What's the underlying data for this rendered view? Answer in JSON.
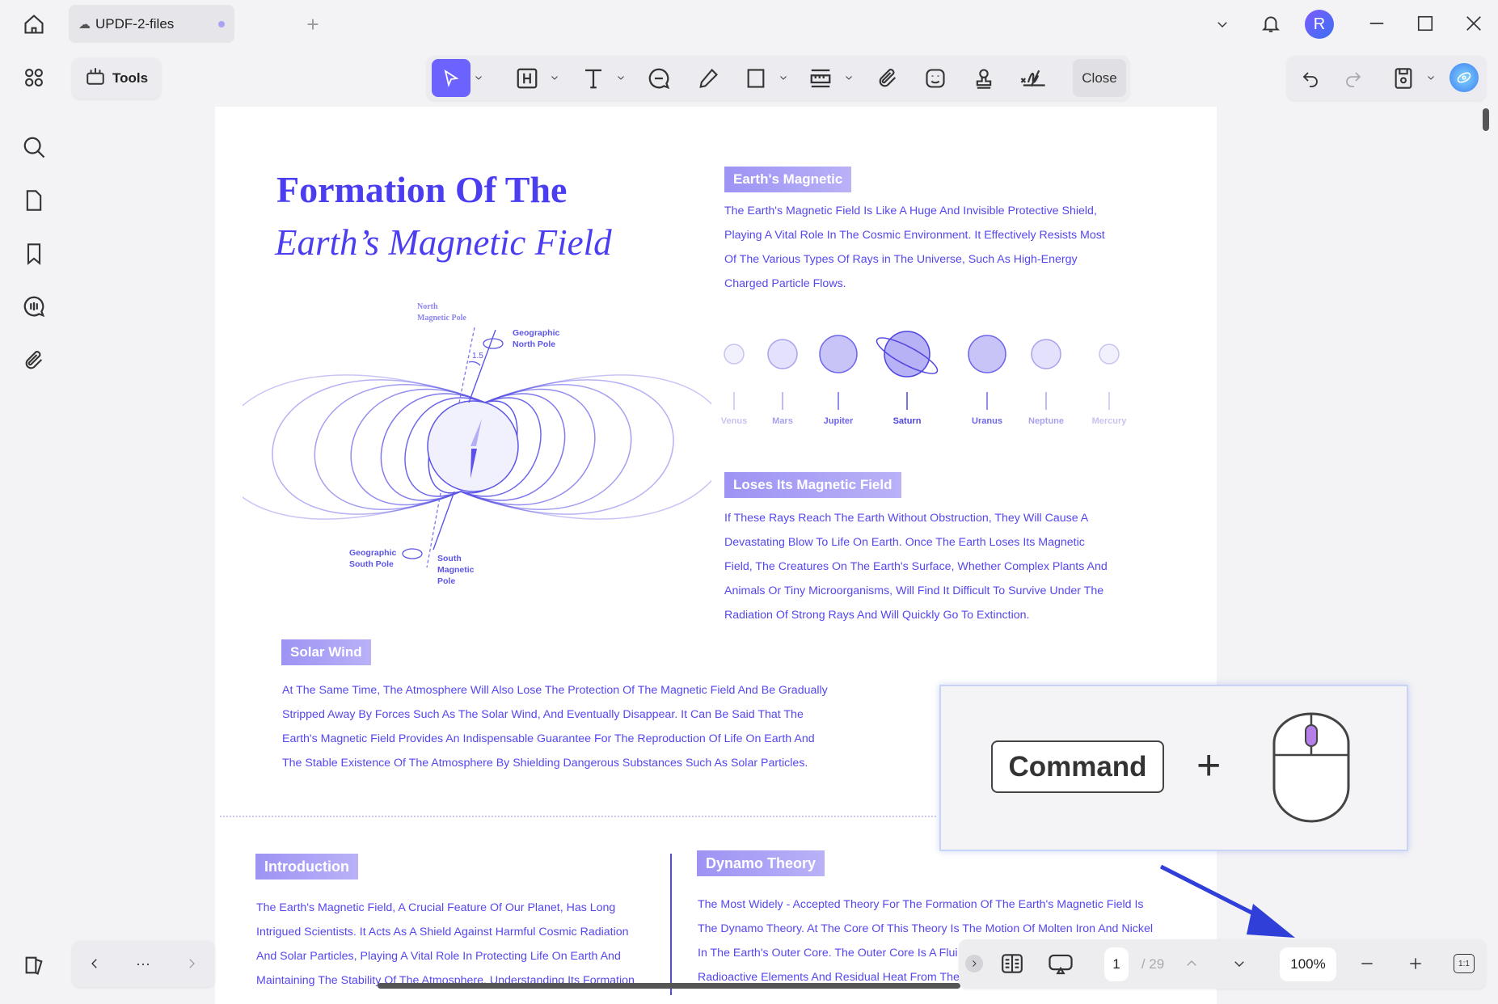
{
  "tab": {
    "title": "UPDF-2-files"
  },
  "toolbar": {
    "tools_label": "Tools",
    "close_label": "Close"
  },
  "document": {
    "title_line1": "Formation Of The",
    "title_line2": "Earth’s Magnetic Field",
    "diagram": {
      "north_magnetic": "North",
      "north_magnetic2": "Magnetic Pole",
      "geo_north": "Geographic",
      "geo_north2": "North Pole",
      "angle": "1.5",
      "geo_south": "Geographic",
      "geo_south2": "South Pole",
      "south_magnetic": "South",
      "south_magnetic2": "Magnetic",
      "south_magnetic3": "Pole"
    },
    "earths_magnetic": {
      "heading": "Earth's Magnetic",
      "lines": [
        "The Earth's Magnetic Field Is Like A Huge And Invisible Protective Shield,",
        "Playing A Vital Role In The Cosmic Environment. It Effectively Resists Most",
        "Of The Various Types Of Rays in The Universe, Such As High-Energy",
        "Charged Particle Flows."
      ]
    },
    "planets": [
      "Venus",
      "Mars",
      "Jupiter",
      "Saturn",
      "Uranus",
      "Neptune",
      "Mercury"
    ],
    "loses": {
      "heading": "Loses Its Magnetic Field",
      "lines": [
        "If These Rays Reach The Earth Without Obstruction, They Will Cause A",
        "Devastating Blow To Life On Earth. Once The Earth Loses Its Magnetic",
        "Field, The Creatures On The Earth's Surface, Whether Complex Plants And",
        "Animals Or Tiny Microorganisms, Will Find It Difficult To Survive Under The",
        "Radiation Of Strong Rays And Will Quickly Go To Extinction."
      ]
    },
    "solar_wind": {
      "heading": "Solar Wind",
      "lines": [
        "At The Same Time, The Atmosphere Will Also Lose The Protection Of The Magnetic Field And Be Gradually",
        "Stripped Away By Forces Such As The Solar Wind, And Eventually Disappear. It Can Be Said That The",
        "Earth's Magnetic Field Provides An Indispensable Guarantee For The Reproduction Of Life On Earth And",
        "The Stable Existence Of The Atmosphere By Shielding Dangerous Substances Such As Solar Particles."
      ]
    },
    "introduction": {
      "heading": "Introduction",
      "lines": [
        "The Earth's Magnetic Field, A Crucial Feature Of Our Planet, Has Long",
        "Intrigued Scientists. It Acts As A Shield Against Harmful Cosmic Radiation",
        "And Solar Particles, Playing A Vital Role In Protecting Life On Earth And",
        "Maintaining The Stability Of The Atmosphere. Understanding Its Formation"
      ]
    },
    "dynamo": {
      "heading": "Dynamo Theory",
      "lines": [
        "The Most Widely - Accepted Theory For The Formation Of The Earth's Magnetic Field Is",
        "The Dynamo Theory. At The Core Of This Theory Is The Motion Of Molten Iron And Nickel",
        "In The Earth's Outer Core. The Outer Core Is A Flui",
        "Radioactive Elements And Residual Heat From The"
      ]
    }
  },
  "overlay": {
    "key_label": "Command",
    "plus": "+"
  },
  "bottom": {
    "page_current": "1",
    "page_total": "/ 29",
    "zoom": "100%",
    "fit_label": "1:1",
    "more": "···"
  },
  "user": {
    "avatar_letter": "R"
  },
  "colors": {
    "accent": "#6c63ff",
    "text": "#5547ee"
  }
}
